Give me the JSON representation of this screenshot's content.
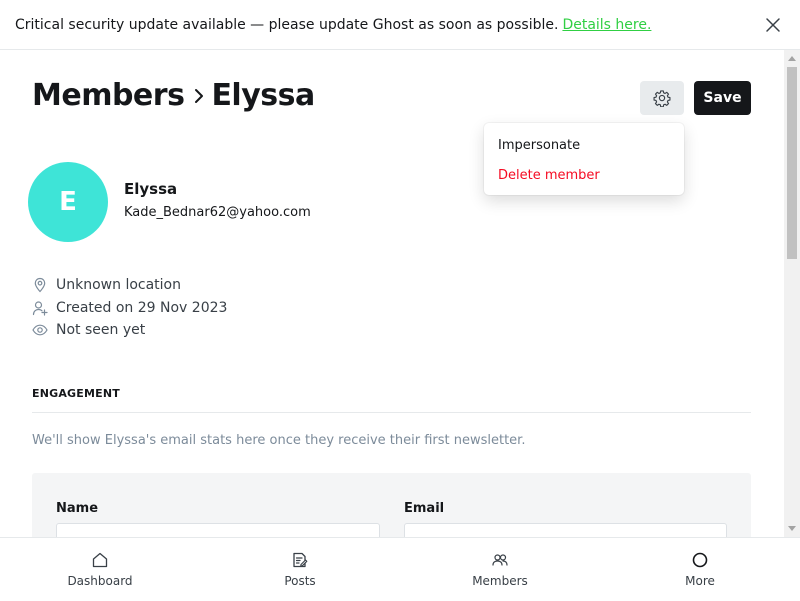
{
  "banner": {
    "message": "Critical security update available — please update Ghost as soon as possible.",
    "link_text": "Details here."
  },
  "breadcrumb": {
    "root": "Members",
    "current": "Elyssa"
  },
  "toolbar": {
    "settings_icon": "gear-icon",
    "save_label": "Save"
  },
  "dropdown": {
    "items": [
      {
        "label": "Impersonate",
        "style": "normal"
      },
      {
        "label": "Delete member",
        "style": "danger"
      }
    ]
  },
  "member": {
    "initial": "E",
    "avatar_color": "#3ee4d7",
    "name": "Elyssa",
    "email": "Kade_Bednar62@yahoo.com"
  },
  "meta": {
    "location": "Unknown location",
    "created": "Created on 29 Nov 2023",
    "last_seen": "Not seen yet"
  },
  "engagement": {
    "title": "ENGAGEMENT",
    "note": "We'll show Elyssa's email stats here once they receive their first newsletter."
  },
  "form": {
    "name_label": "Name",
    "name_value": "",
    "email_label": "Email",
    "email_value": ""
  },
  "nav": {
    "items": [
      {
        "label": "Dashboard",
        "icon": "home-icon"
      },
      {
        "label": "Posts",
        "icon": "posts-icon"
      },
      {
        "label": "Members",
        "icon": "members-icon"
      },
      {
        "label": "More",
        "icon": "circle-icon"
      }
    ]
  },
  "colors": {
    "accent_link": "#30cf43",
    "danger": "#f50b23",
    "primary_button": "#15171a"
  }
}
